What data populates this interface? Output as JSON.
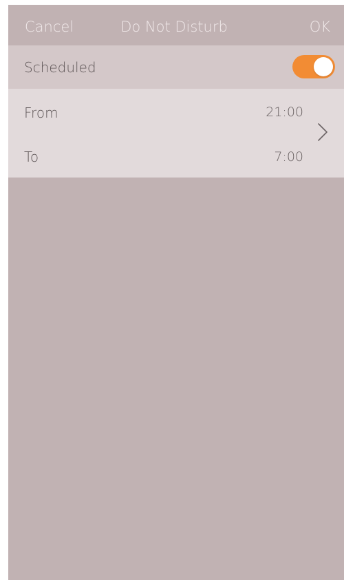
{
  "navbar": {
    "cancel_label": "Cancel",
    "title": "Do Not Disturb",
    "ok_label": "OK"
  },
  "scheduled": {
    "label": "Scheduled",
    "enabled": true,
    "toggle_color": "#f28c34"
  },
  "schedule": {
    "from_label": "From",
    "from_value": "21:00",
    "to_label": "To",
    "to_value": "7:00",
    "chevron_icon": "chevron-right-icon"
  },
  "colors": {
    "background": "#c1b2b3",
    "scheduled_row": "#d4c8c9",
    "schedule_block": "#e2dadb",
    "nav_text": "#f0e8e9"
  }
}
